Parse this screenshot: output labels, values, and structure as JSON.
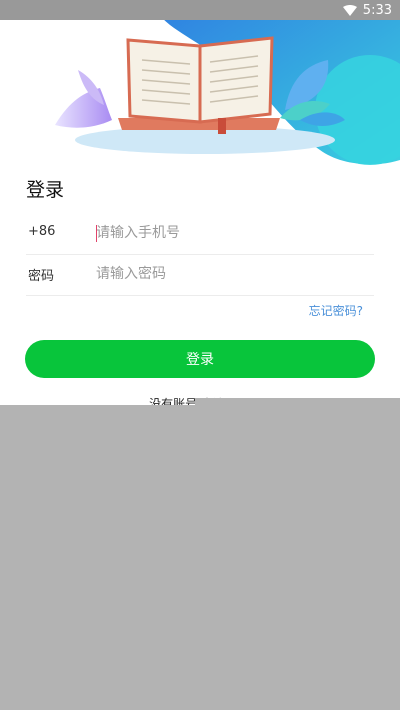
{
  "status_bar": {
    "time": "5:33",
    "icons": [
      "wifi-icon",
      "battery-icon"
    ]
  },
  "banner": {
    "illustration": "open-book-illustration"
  },
  "login": {
    "title": "登录",
    "country_code": "+86",
    "phone_placeholder": "请输入手机号",
    "password_label": "密码",
    "password_placeholder": "请输入密码",
    "forgot_label": "忘记密码?",
    "submit_label": "登录",
    "register_text": "没有账号,去注册 >"
  },
  "colors": {
    "accent_green": "#08c53b",
    "link_blue": "#4a90d9",
    "caret": "#e0436a",
    "overlay": "#b3b3b3"
  }
}
